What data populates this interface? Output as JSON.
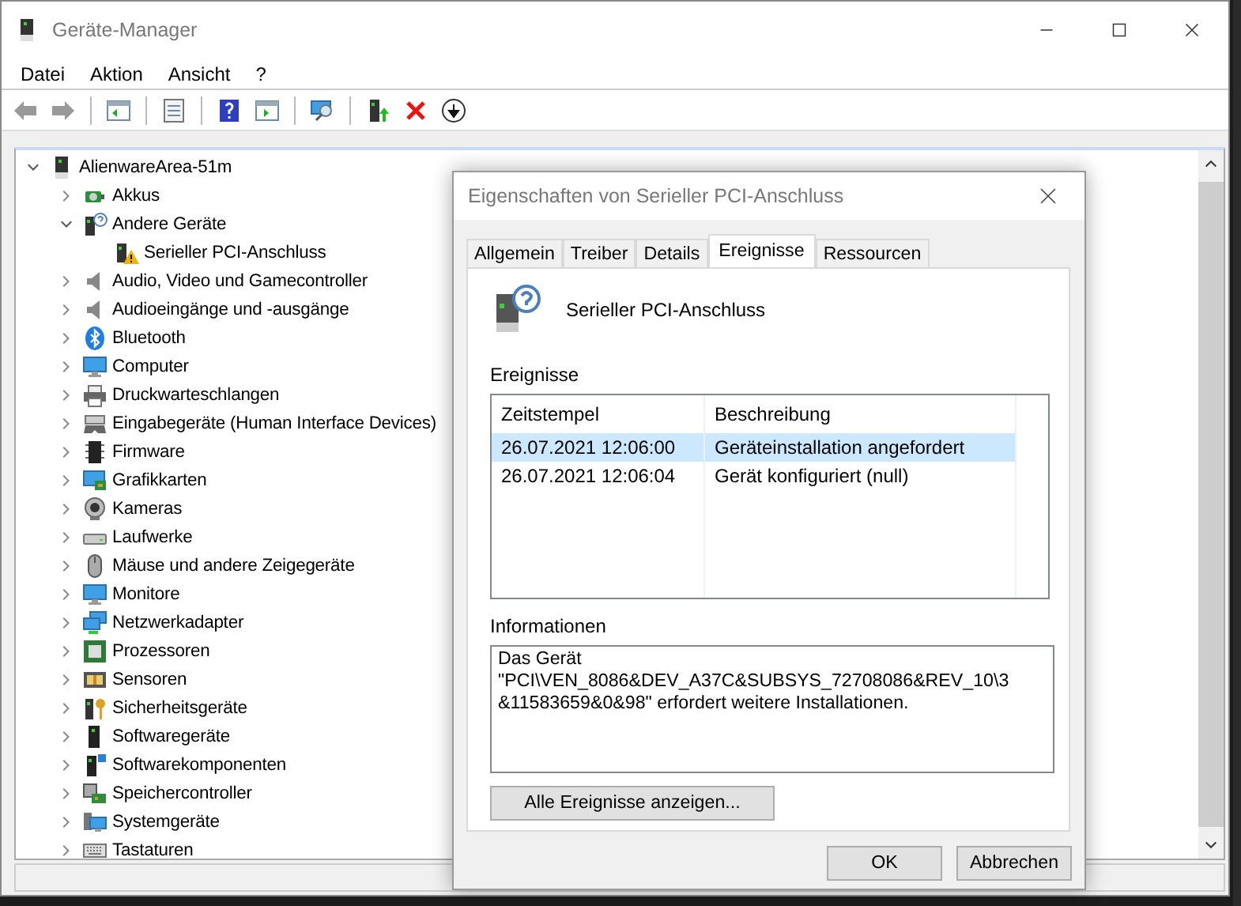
{
  "window": {
    "title": "Geräte-Manager"
  },
  "menu": [
    "Datei",
    "Aktion",
    "Ansicht",
    "?"
  ],
  "tree": {
    "label": "AlienwareArea-51m",
    "expanded": true,
    "children": [
      {
        "label": "Akkus",
        "expanded": false
      },
      {
        "label": "Andere Geräte",
        "expanded": true,
        "children": [
          {
            "label": "Serieller PCI-Anschluss"
          }
        ]
      },
      {
        "label": "Audio, Video und Gamecontroller",
        "expanded": false
      },
      {
        "label": "Audioeingänge und -ausgänge",
        "expanded": false
      },
      {
        "label": "Bluetooth",
        "expanded": false
      },
      {
        "label": "Computer",
        "expanded": false
      },
      {
        "label": "Druckwarteschlangen",
        "expanded": false
      },
      {
        "label": "Eingabegeräte (Human Interface Devices)",
        "expanded": false
      },
      {
        "label": "Firmware",
        "expanded": false
      },
      {
        "label": "Grafikkarten",
        "expanded": false
      },
      {
        "label": "Kameras",
        "expanded": false
      },
      {
        "label": "Laufwerke",
        "expanded": false
      },
      {
        "label": "Mäuse und andere Zeigegeräte",
        "expanded": false
      },
      {
        "label": "Monitore",
        "expanded": false
      },
      {
        "label": "Netzwerkadapter",
        "expanded": false
      },
      {
        "label": "Prozessoren",
        "expanded": false
      },
      {
        "label": "Sensoren",
        "expanded": false
      },
      {
        "label": "Sicherheitsgeräte",
        "expanded": false
      },
      {
        "label": "Softwaregeräte",
        "expanded": false
      },
      {
        "label": "Softwarekomponenten",
        "expanded": false
      },
      {
        "label": "Speichercontroller",
        "expanded": false
      },
      {
        "label": "Systemgeräte",
        "expanded": false
      },
      {
        "label": "Tastaturen",
        "expanded": false
      }
    ]
  },
  "dialog": {
    "title": "Eigenschaften von Serieller PCI-Anschluss",
    "tabs": [
      {
        "label": "Allgemein",
        "selected": false
      },
      {
        "label": "Treiber",
        "selected": false
      },
      {
        "label": "Details",
        "selected": false
      },
      {
        "label": "Ereignisse",
        "selected": true
      },
      {
        "label": "Ressourcen",
        "selected": false
      }
    ],
    "device_name": "Serieller PCI-Anschluss",
    "events_label": "Ereignisse",
    "events": {
      "columns": [
        "Zeitstempel",
        "Beschreibung"
      ],
      "rows": [
        {
          "cells": [
            "26.07.2021 12:06:00",
            "Geräteinstallation angefordert"
          ],
          "selected": true
        },
        {
          "cells": [
            "26.07.2021 12:06:04",
            "Gerät konfiguriert (null)"
          ],
          "selected": false
        }
      ]
    },
    "info_label": "Informationen",
    "info_text": "Das Gerät \"PCI\\VEN_8086&DEV_A37C&SUBSYS_72708086&REV_10\\3&11583659&0&98\" erfordert weitere Installationen.",
    "all_events_button": "Alle Ereignisse anzeigen...",
    "footer_buttons": [
      "OK",
      "Abbrechen"
    ]
  }
}
